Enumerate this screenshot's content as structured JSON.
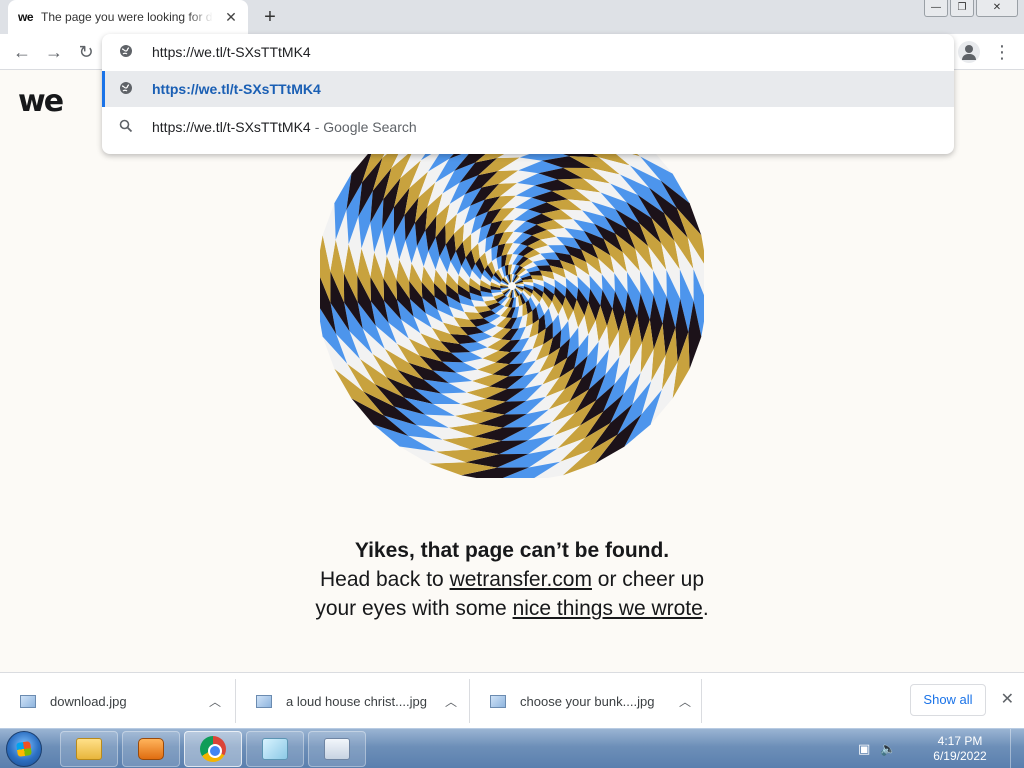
{
  "tab": {
    "favicon": "we",
    "title": "The page you were looking for d",
    "close": "✕"
  },
  "new_tab": "+",
  "window_controls": {
    "minimize": "—",
    "restore": "❐",
    "close": "✕"
  },
  "nav": {
    "back": "←",
    "forward": "→",
    "reload": "↻",
    "menu": "⋮"
  },
  "omnibox": {
    "input_value": "https://we.tl/t-SXsTTtMK4",
    "suggestions": [
      {
        "text": "https://we.tl/t-SXsTTtMK4",
        "suffix": "",
        "icon": "globe-icon"
      },
      {
        "text": "https://we.tl/t-SXsTTtMK4",
        "suffix": "- Google Search",
        "icon": "search-icon"
      }
    ]
  },
  "page": {
    "logo": "we",
    "headline": "Yikes, that page can’t be found.",
    "line_a": "Head back to ",
    "link_site": "wetransfer.com",
    "line_b": " or cheer up your eyes with some ",
    "link_things": "nice things we wrote",
    "line_end": "."
  },
  "downloads": {
    "items": [
      {
        "name": "download.jpg"
      },
      {
        "name": "a loud house christ....jpg"
      },
      {
        "name": "choose your bunk....jpg"
      }
    ],
    "show_all": "Show all",
    "close": "✕"
  },
  "taskbar": {
    "time": "4:17 PM",
    "date": "6/19/2022"
  },
  "colors": {
    "spiral": [
      "#1c1219",
      "#c8a23e",
      "#f2f2f2",
      "#4d95ec"
    ],
    "page_bg": "#fcfaf6"
  }
}
